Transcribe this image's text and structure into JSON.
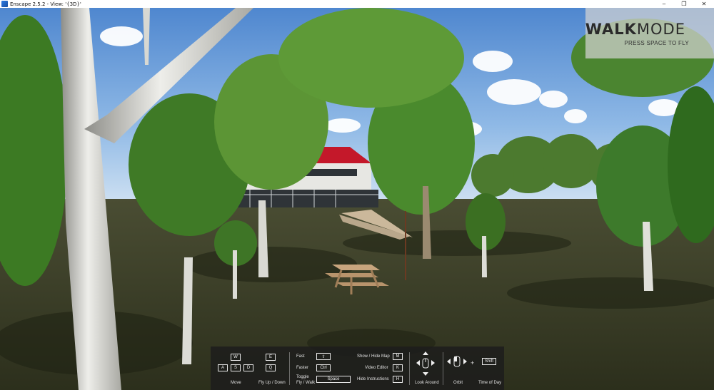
{
  "window": {
    "title": "Enscape 2.5.2 - View: '{3D}'",
    "controls": {
      "minimize": "–",
      "maximize": "❐",
      "close": "✕"
    }
  },
  "overlay": {
    "walk": "WALK",
    "mode": "MODE",
    "hint": "PRESS SPACE TO FLY"
  },
  "help": {
    "move": {
      "keys": [
        "W",
        "A",
        "S",
        "D"
      ],
      "label": "Move"
    },
    "fly": {
      "keys": [
        "E",
        "Q"
      ],
      "label": "Fly Up / Down"
    },
    "speed": {
      "fast_label": "Fast",
      "fast_key": "⇧",
      "faster_label": "Faster",
      "faster_key": "Ctrl",
      "toggle_label_1": "Toggle",
      "toggle_label_2": "Fly / Walk",
      "toggle_key": "Space"
    },
    "toggles": [
      {
        "label": "Show / Hide Map",
        "key": "M"
      },
      {
        "label": "Video Editor",
        "key": "K"
      },
      {
        "label": "Hide Instructions",
        "key": "H"
      }
    ],
    "look_label": "Look Around",
    "orbit_label": "Orbit",
    "plus": "+",
    "time_key": "Shift",
    "time_label": "Time of Day"
  },
  "colors": {
    "sky": "#6fa3dc",
    "grass": "#3d4128",
    "roof": "#c4182a",
    "panel": "#1c1c1c"
  }
}
